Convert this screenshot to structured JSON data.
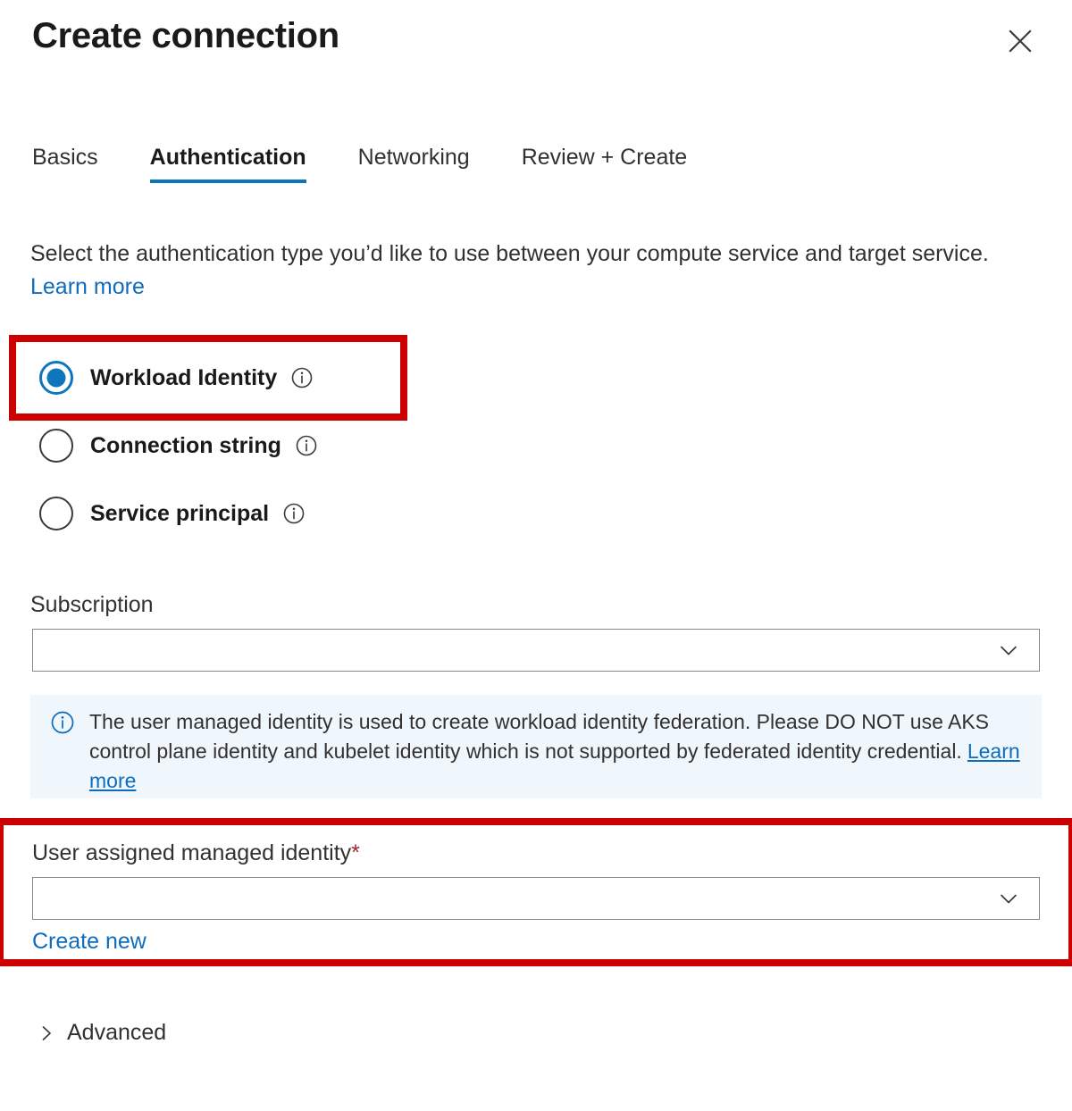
{
  "header": {
    "title": "Create connection",
    "close_icon": "close-icon"
  },
  "tabs": [
    {
      "label": "Basics",
      "active": false
    },
    {
      "label": "Authentication",
      "active": true
    },
    {
      "label": "Networking",
      "active": false
    },
    {
      "label": "Review + Create",
      "active": false
    }
  ],
  "intro": {
    "text": "Select the authentication type you’d like to use between your compute service and target service.",
    "link_label": "Learn more"
  },
  "auth_types": [
    {
      "label": "Workload Identity",
      "checked": true,
      "info_icon": "info-icon"
    },
    {
      "label": "Connection string",
      "checked": false,
      "info_icon": "info-icon"
    },
    {
      "label": "Service principal",
      "checked": false,
      "info_icon": "info-icon"
    }
  ],
  "subscription": {
    "label": "Subscription",
    "value": "",
    "placeholder": "",
    "chevron_icon": "chevron-down-icon"
  },
  "info_banner": {
    "icon": "info-circle-icon",
    "text": "The user managed identity is used to create workload identity federation. Please DO NOT use AKS control plane identity and kubelet identity which is not supported by federated identity credential.",
    "link_label": "Learn more"
  },
  "user_identity": {
    "label": "User assigned managed identity",
    "required_marker": "*",
    "value": "",
    "placeholder": "",
    "chevron_icon": "chevron-down-icon",
    "create_new_label": "Create new"
  },
  "advanced": {
    "label": "Advanced",
    "chevron_icon": "chevron-right-icon"
  },
  "highlights": [
    {
      "name": "auth-type-highlight",
      "color": "#cc0000"
    },
    {
      "name": "user-identity-highlight",
      "color": "#cc0000"
    }
  ],
  "colors": {
    "accent": "#0f76bc",
    "link": "#0f6cbd",
    "highlight_red": "#cc0000",
    "required_red": "#a4262c",
    "banner_bg": "#eff6fc"
  }
}
